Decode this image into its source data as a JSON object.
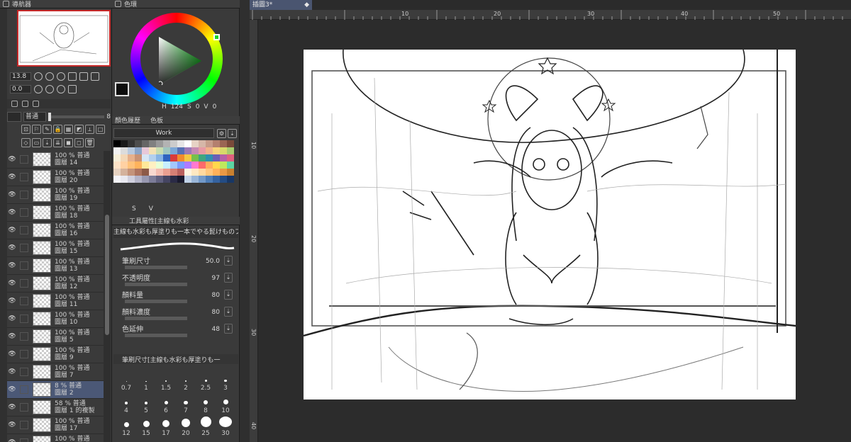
{
  "panels": {
    "navigator_tab": "導航器",
    "color_tab": "色環",
    "palette_tabs": [
      "顏色履歷",
      "色板"
    ],
    "tool_property_tab": "工具屬性[主線も水彩",
    "brush_size_tab": "筆刷尺寸[主線も水彩も厚塗りも一"
  },
  "navigator": {
    "zoom": "13.8",
    "rotation": "0.0"
  },
  "layers": {
    "blend_mode": "普通",
    "opacity_value": "8",
    "items": [
      {
        "pct": "100 %",
        "mode": "普通",
        "name": "圖層 14"
      },
      {
        "pct": "100 %",
        "mode": "普通",
        "name": "圖層 20"
      },
      {
        "pct": "100 %",
        "mode": "普通",
        "name": "圖層 19"
      },
      {
        "pct": "100 %",
        "mode": "普通",
        "name": "圖層 18"
      },
      {
        "pct": "100 %",
        "mode": "普通",
        "name": "圖層 16"
      },
      {
        "pct": "100 %",
        "mode": "普通",
        "name": "圖層 15"
      },
      {
        "pct": "100 %",
        "mode": "普通",
        "name": "圖層 13"
      },
      {
        "pct": "100 %",
        "mode": "普通",
        "name": "圖層 12"
      },
      {
        "pct": "100 %",
        "mode": "普通",
        "name": "圖層 11"
      },
      {
        "pct": "100 %",
        "mode": "普通",
        "name": "圖層 10"
      },
      {
        "pct": "100 %",
        "mode": "普通",
        "name": "圖層 5"
      },
      {
        "pct": "100 %",
        "mode": "普通",
        "name": "圖層 9"
      },
      {
        "pct": "100 %",
        "mode": "普通",
        "name": "圖層 7"
      },
      {
        "pct": "8 %",
        "mode": "普通",
        "name": "圖層 2"
      },
      {
        "pct": "58 %",
        "mode": "普通",
        "name": "圖層 1 的複製"
      },
      {
        "pct": "100 %",
        "mode": "普通",
        "name": "圖層 17"
      },
      {
        "pct": "100 %",
        "mode": "普通",
        "name": "圖層"
      }
    ]
  },
  "color": {
    "fg": "#0d0d0d",
    "bg": "#1e3244",
    "h_label": "H",
    "h": "124",
    "s_label": "S",
    "s": "0",
    "v_label": "V",
    "v": "0"
  },
  "palette": {
    "set_name": "Work",
    "footer": [
      "S",
      "V"
    ],
    "colors": [
      "#000",
      "#1a1a1a",
      "#333",
      "#4d4d4d",
      "#666",
      "#808080",
      "#999",
      "#b3b3b3",
      "#ccc",
      "#e6e6e6",
      "#fff",
      "#e7d3c5",
      "#d6b7a8",
      "#c79b8a",
      "#b4806f",
      "#9a6553",
      "#7a4a3a",
      "#f2f2f2",
      "#dcdcdc",
      "#b8c9de",
      "#8aa4c7",
      "#e8c8d8",
      "#f4e2b5",
      "#c8ddb0",
      "#9fc7c0",
      "#7ca7d6",
      "#5671b5",
      "#9a7ab8",
      "#c68ab3",
      "#e79aa4",
      "#f0b18a",
      "#f6d27b",
      "#d9d96a",
      "#a7cc6e",
      "#f7efd9",
      "#f3d7b6",
      "#e6b08b",
      "#c99274",
      "#d7e6f4",
      "#b3d0ee",
      "#86b3e4",
      "#2e63c0",
      "#d93b3b",
      "#f28b2e",
      "#f5c842",
      "#76c14a",
      "#3fa67f",
      "#2f8fb0",
      "#6b5fb5",
      "#b65fa8",
      "#e0607e",
      "#fde3c8",
      "#ffd1a3",
      "#ffc27a",
      "#ffb35c",
      "#ffe89a",
      "#fff0c2",
      "#e7ffd6",
      "#c8f0ff",
      "#a3c8ff",
      "#7a9cff",
      "#b07aff",
      "#ff7ad0",
      "#ff6b6b",
      "#ffad5c",
      "#ffd84d",
      "#bfe85c",
      "#5cd6a3",
      "#e6d2c1",
      "#d4b29c",
      "#c4937a",
      "#ae7560",
      "#8d5a48",
      "#f7d9d0",
      "#f2bcb0",
      "#e99f91",
      "#d67f75",
      "#b9605d",
      "#fff5e0",
      "#ffe9c2",
      "#ffd9a0",
      "#ffc77d",
      "#ffb15a",
      "#e89845",
      "#c9802f",
      "#f4f4f8",
      "#e9e9f0",
      "#d0d0de",
      "#b4b4c8",
      "#9898b0",
      "#7c7c98",
      "#60607e",
      "#454562",
      "#2b2b46",
      "#1a1a2e",
      "#c1d3e8",
      "#9ab6d8",
      "#7399c8",
      "#4d7cb6",
      "#3563a0",
      "#244c84",
      "#183766"
    ]
  },
  "tool_property": {
    "brush_name": "主線も水彩も厚塗りも一本でやる髭けものブラシ",
    "props": [
      {
        "label": "筆刷尺寸",
        "value": "50.0"
      },
      {
        "label": "不透明度",
        "value": "97"
      },
      {
        "label": "顏料量",
        "value": "80"
      },
      {
        "label": "顏料濃度",
        "value": "80"
      },
      {
        "label": "色延伸",
        "value": "48"
      }
    ]
  },
  "brush_sizes": [
    {
      "label": "0.7"
    },
    {
      "label": "1"
    },
    {
      "label": "1.5"
    },
    {
      "label": "2"
    },
    {
      "label": "2.5"
    },
    {
      "label": "3"
    },
    {
      "label": "4"
    },
    {
      "label": "5"
    },
    {
      "label": "6"
    },
    {
      "label": "7"
    },
    {
      "label": "8"
    },
    {
      "label": "10"
    },
    {
      "label": "12"
    },
    {
      "label": "15"
    },
    {
      "label": "17"
    },
    {
      "label": "20"
    },
    {
      "label": "25"
    },
    {
      "label": "30"
    }
  ],
  "document": {
    "tab_title": "插圖3*",
    "ruler_top_labels": [
      "10",
      "20",
      "30",
      "40",
      "50"
    ],
    "ruler_left_labels": [
      "10",
      "20",
      "30",
      "40"
    ]
  }
}
